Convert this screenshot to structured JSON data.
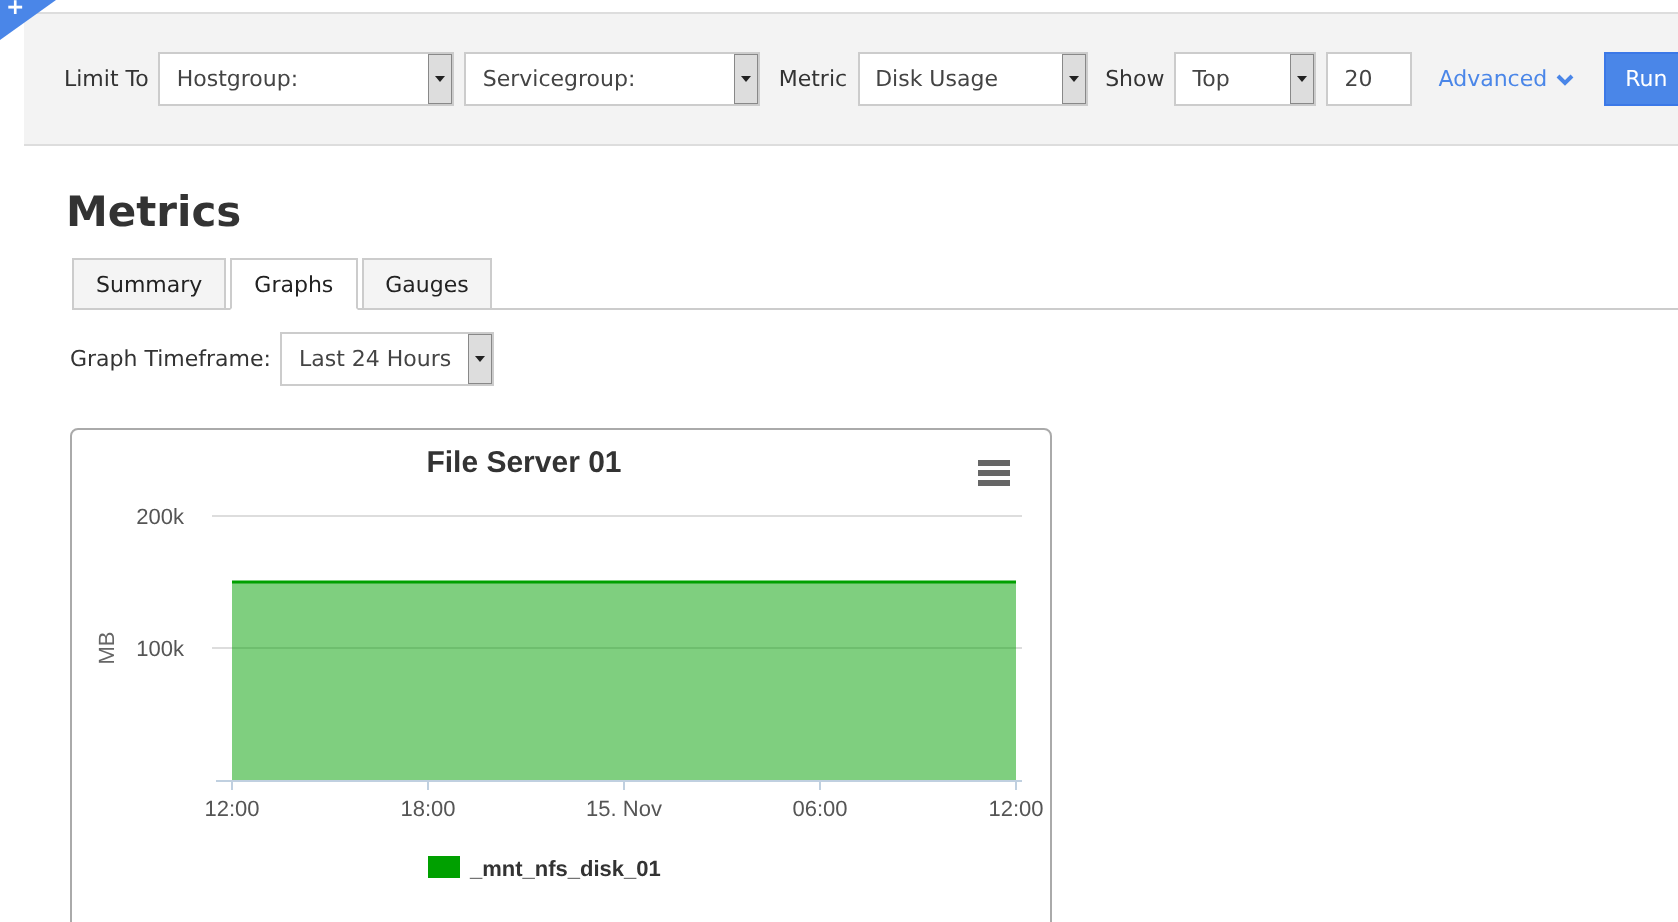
{
  "corner_badge": {
    "label": "+"
  },
  "toolbar": {
    "limit_label": "Limit To",
    "hostgroup": {
      "value": "Hostgroup:"
    },
    "servicegroup": {
      "value": "Servicegroup:"
    },
    "metric_label": "Metric",
    "metric": {
      "value": "Disk Usage"
    },
    "show_label": "Show",
    "show": {
      "value": "Top"
    },
    "count": {
      "value": "20"
    },
    "advanced": "Advanced",
    "run": "Run"
  },
  "page_title": "Metrics",
  "tabs": [
    {
      "label": "Summary",
      "selected": false
    },
    {
      "label": "Graphs",
      "selected": true
    },
    {
      "label": "Gauges",
      "selected": false
    }
  ],
  "timeframe": {
    "label": "Graph Timeframe:",
    "value": "Last 24 Hours"
  },
  "graph": {
    "chart_data": {
      "type": "area",
      "title": "File Server 01",
      "ylabel": "MB",
      "categories": [
        "12:00",
        "18:00",
        "15. Nov",
        "06:00",
        "12:00"
      ],
      "series": [
        {
          "name": "_mnt_nfs_disk_01",
          "color": "#00a000",
          "values": [
            150000,
            150000,
            150000,
            150000,
            150000
          ]
        }
      ],
      "ylim": [
        0,
        200000
      ],
      "yticks": [
        {
          "value": 100000,
          "label": "100k"
        },
        {
          "value": 200000,
          "label": "200k"
        }
      ]
    }
  }
}
